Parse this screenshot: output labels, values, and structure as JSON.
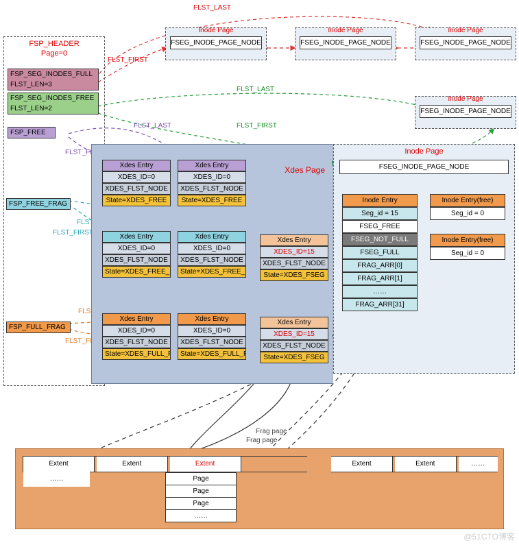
{
  "fsp_header": {
    "title_line1": "FSP_HEADER",
    "title_line2": "Page=0",
    "blocks": {
      "full": {
        "name": "FSP_SEG_INODES_FULL",
        "len": "FLST_LEN=3"
      },
      "free": {
        "name": "FSP_SEG_INODES_FREE",
        "len": "FLST_LEN=2"
      },
      "fsp_free": {
        "name": "FSP_FREE"
      },
      "free_frag": {
        "name": "FSP_FREE_FRAG"
      },
      "full_frag": {
        "name": "FSP_FULL_FRAG"
      }
    }
  },
  "labels": {
    "flst_last": "FLST_LAST",
    "flst_first": "FLST_FIRST",
    "frag_page": "Frag page"
  },
  "inode_page": {
    "title": "Inode Page",
    "node": "FSEG_INODE_PAGE_NODE"
  },
  "xdes": {
    "title": "Xdes Page",
    "entry": {
      "hdr": "Xdes Entry",
      "id0": "XDES_ID=0",
      "id15": "XDES_ID=15",
      "flst": "XDES_FLST_NODE",
      "st_free": "State=XDES_FREE",
      "st_free_frag": "State=XDES_FREE_FRAG",
      "st_full_frag": "State=XDES_FULL_FRAG",
      "st_fseg": "State=XDES_FSEG"
    }
  },
  "inode_entry": {
    "title": "Inode Entry",
    "seg15": "Seg_id = 15",
    "seg0": "Seg_id = 0",
    "fseg_free": "FSEG_FREE",
    "not_full": "FSEG_NOT_FULL",
    "fseg_full": "FSEG_FULL",
    "arr0": "FRAG_ARR[0]",
    "arr1": "FRAG_ARR[1]",
    "dots": "……",
    "arr31": "FRAG_ARR[31]",
    "free_title": "Inode Entry(free)"
  },
  "extent": {
    "label": "Extent",
    "label_red": "Extent",
    "page": "Page",
    "dots": "……"
  },
  "watermark": "@51CTO博客"
}
